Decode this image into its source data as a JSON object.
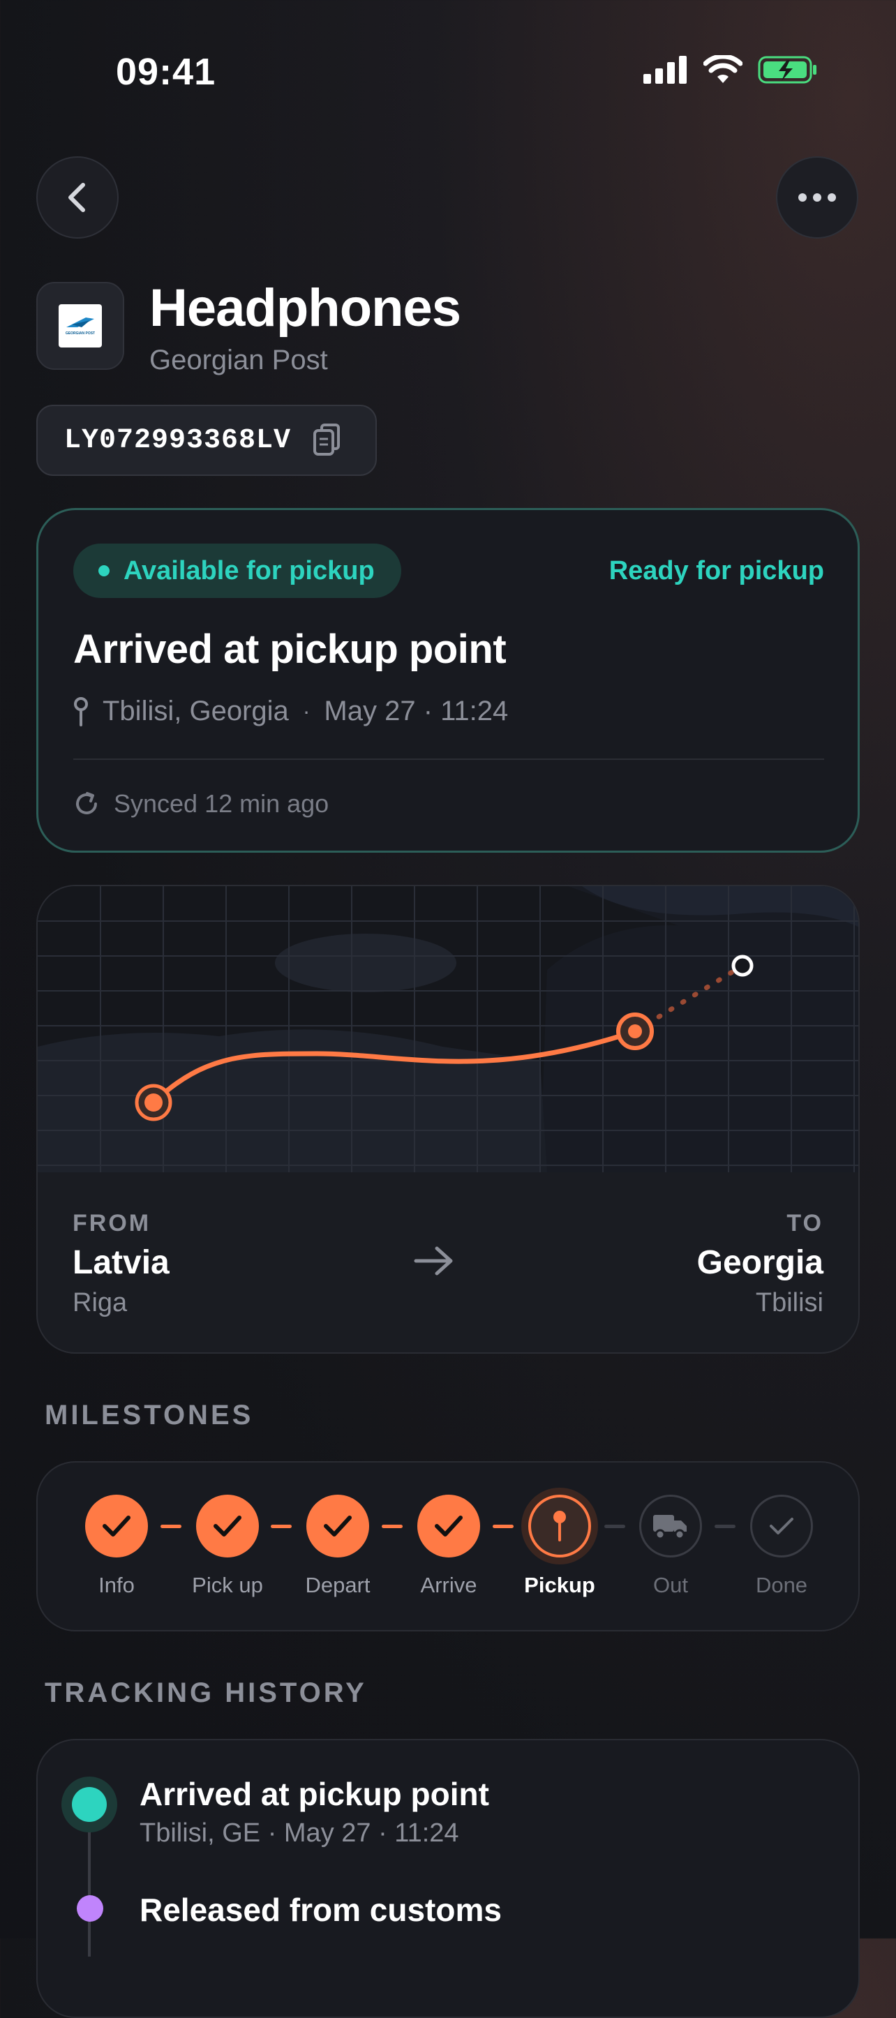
{
  "status_bar": {
    "time": "09:41"
  },
  "header": {
    "title": "Headphones",
    "carrier": "Georgian Post",
    "carrier_logo_text": "GEORGIAN POST",
    "tracking_number": "LY072993368LV"
  },
  "status_card": {
    "badge": "Available for pickup",
    "status_right": "Ready for pickup",
    "title": "Arrived at pickup point",
    "location": "Tbilisi, Georgia",
    "separator": "·",
    "datetime": "May 27 · 11:24",
    "synced": "Synced 12 min ago",
    "accent_color": "#2dd4bf"
  },
  "route": {
    "from_label": "FROM",
    "from_country": "Latvia",
    "from_city": "Riga",
    "to_label": "TO",
    "to_country": "Georgia",
    "to_city": "Tbilisi",
    "route_color": "#ff7a45"
  },
  "milestones": {
    "heading": "MILESTONES",
    "steps": [
      {
        "label": "Info",
        "state": "done",
        "icon": "check-icon"
      },
      {
        "label": "Pick up",
        "state": "done",
        "icon": "check-icon"
      },
      {
        "label": "Depart",
        "state": "done",
        "icon": "check-icon"
      },
      {
        "label": "Arrive",
        "state": "done",
        "icon": "check-icon"
      },
      {
        "label": "Pickup",
        "state": "current",
        "icon": "pin-icon"
      },
      {
        "label": "Out",
        "state": "todo",
        "icon": "truck-icon"
      },
      {
        "label": "Done",
        "state": "todo",
        "icon": "check-icon"
      }
    ]
  },
  "history": {
    "heading": "TRACKING HISTORY",
    "events": [
      {
        "title": "Arrived at pickup point",
        "subtitle": "Tbilisi, GE · May 27 · 11:24",
        "color": "#2dd4bf"
      },
      {
        "title": "Released from customs",
        "subtitle": "",
        "color": "#c084fc"
      }
    ]
  }
}
